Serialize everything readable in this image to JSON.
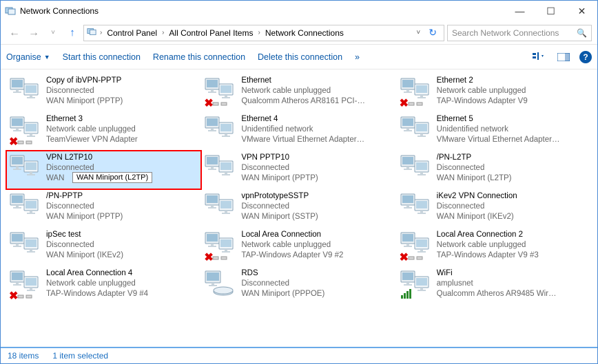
{
  "window": {
    "title": "Network Connections",
    "search_placeholder": "Search Network Connections"
  },
  "breadcrumb": {
    "c1": "Control Panel",
    "c2": "All Control Panel Items",
    "c3": "Network Connections"
  },
  "toolbar": {
    "organise": "Organise",
    "start": "Start this connection",
    "rename": "Rename this connection",
    "delete": "Delete this connection",
    "more": "»"
  },
  "tooltip": {
    "text": "WAN Miniport (L2TP)"
  },
  "status": {
    "items": "18 items",
    "selected": "1 item selected"
  },
  "items": [
    {
      "name": "Copy of ibVPN-PPTP",
      "status": "Disconnected",
      "adapter": "WAN Miniport (PPTP)",
      "type": "vpn",
      "adapter_shown": "WAN Miniport (PPTP)"
    },
    {
      "name": "Ethernet",
      "status": "Network cable unplugged",
      "adapter": "Qualcomm Atheros AR8161 PCI-E...",
      "type": "eth-x"
    },
    {
      "name": "Ethernet 2",
      "status": "Network cable unplugged",
      "adapter": "TAP-Windows Adapter V9",
      "type": "eth-x"
    },
    {
      "name": "Ethernet 3",
      "status": "Network cable unplugged",
      "adapter": "TeamViewer VPN Adapter",
      "type": "eth-x"
    },
    {
      "name": "Ethernet 4",
      "status": "Unidentified network",
      "adapter": "VMware Virtual Ethernet Adapter ...",
      "type": "eth"
    },
    {
      "name": "Ethernet 5",
      "status": "Unidentified network",
      "adapter": "VMware Virtual Ethernet Adapter ...",
      "type": "eth"
    },
    {
      "name": "   VPN L2TP10",
      "status": "Disconnected",
      "adapter": "WAN",
      "type": "vpn",
      "selected": true
    },
    {
      "name": "   VPN PPTP10",
      "status": "Disconnected",
      "adapter": "WAN Miniport (PPTP)",
      "type": "vpn"
    },
    {
      "name": "   /PN-L2TP",
      "status": "Disconnected",
      "adapter": "WAN Miniport (L2TP)",
      "type": "vpn"
    },
    {
      "name": "   /PN-PPTP",
      "status": "Disconnected",
      "adapter": "WAN Miniport (PPTP)",
      "type": "vpn"
    },
    {
      "name": "   vpnPrototypeSSTP",
      "status": "Disconnected",
      "adapter": "WAN Miniport (SSTP)",
      "type": "vpn"
    },
    {
      "name": "iKev2 VPN Connection",
      "status": "Disconnected",
      "adapter": "WAN Miniport (IKEv2)",
      "type": "vpn"
    },
    {
      "name": "ipSec test",
      "status": "Disconnected",
      "adapter": "WAN Miniport (IKEv2)",
      "type": "vpn"
    },
    {
      "name": "Local Area Connection",
      "status": "Network cable unplugged",
      "adapter": "TAP-Windows Adapter V9 #2",
      "type": "eth-x"
    },
    {
      "name": "Local Area Connection 2",
      "status": "Network cable unplugged",
      "adapter": "TAP-Windows Adapter V9 #3",
      "type": "eth-x"
    },
    {
      "name": "Local Area Connection 4",
      "status": "Network cable unplugged",
      "adapter": "TAP-Windows Adapter V9 #4",
      "type": "eth-x"
    },
    {
      "name": "RDS",
      "status": "Disconnected",
      "adapter": "WAN Miniport (PPPOE)",
      "type": "modem"
    },
    {
      "name": "WiFi",
      "status": "amplusnet",
      "adapter": "Qualcomm Atheros AR9485 Wirel...",
      "type": "wifi"
    }
  ]
}
